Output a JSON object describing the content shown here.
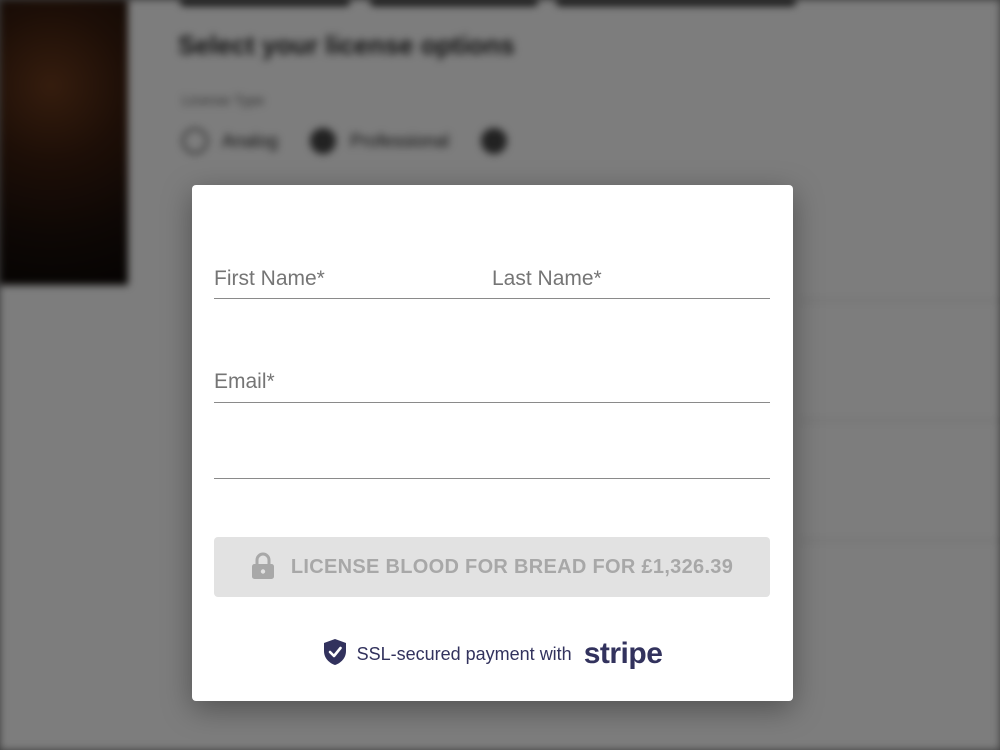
{
  "background": {
    "heading": "Select your license options",
    "license_label": "License Type",
    "radio_options": [
      "Analog",
      "Professional"
    ]
  },
  "form": {
    "first_name_label": "First Name*",
    "last_name_label": "Last Name*",
    "email_label": "Email*",
    "card_field_value": ""
  },
  "pay_button": {
    "label": "LICENSE BLOOD FOR BREAD FOR £1,326.39",
    "icon": "lock-icon"
  },
  "footer": {
    "ssl_text": "SSL-secured payment with",
    "brand": "stripe",
    "icon": "shield-check-icon"
  },
  "colors": {
    "brand": "#32325d",
    "button_disabled_bg": "#e2e2e2",
    "button_disabled_text": "#a8a8a8",
    "label": "#757575"
  }
}
